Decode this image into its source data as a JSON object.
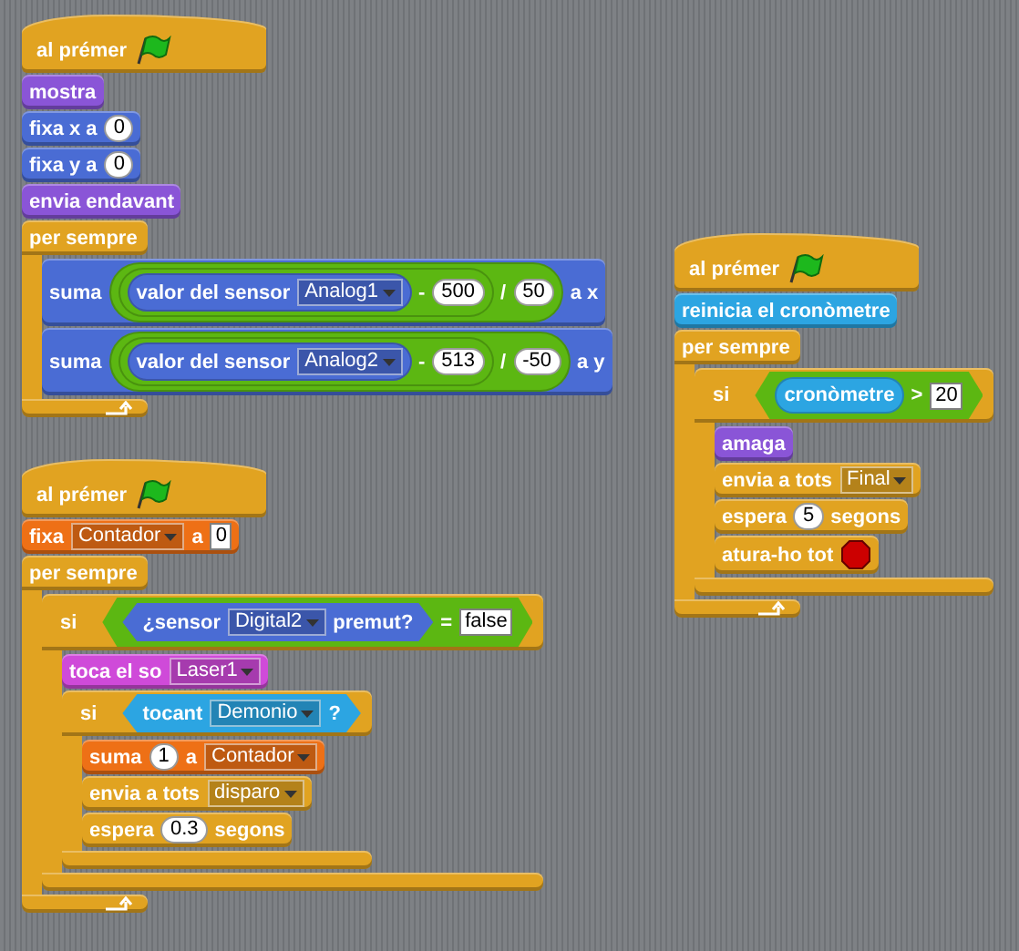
{
  "scripts": [
    {
      "blocks": [
        {
          "kind": "hat",
          "color": "#e1a321",
          "parts": [
            {
              "kind": "text",
              "text": "al prémer"
            },
            {
              "kind": "flag"
            }
          ]
        },
        {
          "kind": "stack",
          "color": "#8a55d7",
          "parts": [
            {
              "kind": "text",
              "text": "mostra"
            }
          ]
        },
        {
          "kind": "stack",
          "color": "#4a6cd4",
          "parts": [
            {
              "kind": "text",
              "text": "fixa x a"
            },
            {
              "kind": "number",
              "text": "0"
            }
          ]
        },
        {
          "kind": "stack",
          "color": "#4a6cd4",
          "parts": [
            {
              "kind": "text",
              "text": "fixa y a"
            },
            {
              "kind": "number",
              "text": "0"
            }
          ]
        },
        {
          "kind": "stack",
          "color": "#8a55d7",
          "parts": [
            {
              "kind": "text",
              "text": "envia endavant"
            }
          ]
        },
        {
          "kind": "forever",
          "color": "#e1a321",
          "parts": [
            {
              "kind": "text",
              "text": "per sempre"
            }
          ],
          "children": [
            {
              "kind": "stack",
              "color": "#4a6cd4",
              "parts": [
                {
                  "kind": "text",
                  "text": "suma"
                },
                {
                  "kind": "reporter",
                  "color": "#5cb712",
                  "parts": [
                    {
                      "kind": "reporter",
                      "color": "#5cb712",
                      "parts": [
                        {
                          "kind": "reporter",
                          "color": "#4a6cd4",
                          "parts": [
                            {
                              "kind": "text",
                              "text": "valor del sensor"
                            },
                            {
                              "kind": "dropdown",
                              "text": "Analog1"
                            }
                          ]
                        },
                        {
                          "kind": "text",
                          "text": "-"
                        },
                        {
                          "kind": "number",
                          "text": "500"
                        }
                      ]
                    },
                    {
                      "kind": "text",
                      "text": "/"
                    },
                    {
                      "kind": "number",
                      "text": "50"
                    }
                  ]
                },
                {
                  "kind": "text",
                  "text": "a x"
                }
              ]
            },
            {
              "kind": "stack",
              "color": "#4a6cd4",
              "parts": [
                {
                  "kind": "text",
                  "text": "suma"
                },
                {
                  "kind": "reporter",
                  "color": "#5cb712",
                  "parts": [
                    {
                      "kind": "reporter",
                      "color": "#5cb712",
                      "parts": [
                        {
                          "kind": "reporter",
                          "color": "#4a6cd4",
                          "parts": [
                            {
                              "kind": "text",
                              "text": "valor del sensor"
                            },
                            {
                              "kind": "dropdown",
                              "text": "Analog2"
                            }
                          ]
                        },
                        {
                          "kind": "text",
                          "text": "-"
                        },
                        {
                          "kind": "number",
                          "text": "513"
                        }
                      ]
                    },
                    {
                      "kind": "text",
                      "text": "/"
                    },
                    {
                      "kind": "number",
                      "text": "-50"
                    }
                  ]
                },
                {
                  "kind": "text",
                  "text": "a y"
                }
              ]
            }
          ]
        }
      ]
    },
    {
      "blocks": [
        {
          "kind": "hat",
          "color": "#e1a321",
          "parts": [
            {
              "kind": "text",
              "text": "al prémer"
            },
            {
              "kind": "flag"
            }
          ]
        },
        {
          "kind": "stack",
          "color": "#2ca5e2",
          "parts": [
            {
              "kind": "text",
              "text": "reinicia el cronòmetre"
            }
          ]
        },
        {
          "kind": "forever",
          "color": "#e1a321",
          "parts": [
            {
              "kind": "text",
              "text": "per sempre"
            }
          ],
          "children": [
            {
              "kind": "if",
              "color": "#e1a321",
              "parts": [
                {
                  "kind": "text",
                  "text": "si"
                },
                {
                  "kind": "boolean",
                  "color": "#5cb712",
                  "parts": [
                    {
                      "kind": "reporter",
                      "color": "#2ca5e2",
                      "parts": [
                        {
                          "kind": "text",
                          "text": "cronòmetre"
                        }
                      ]
                    },
                    {
                      "kind": "text",
                      "text": ">"
                    },
                    {
                      "kind": "field",
                      "text": "20"
                    }
                  ]
                }
              ],
              "children": [
                {
                  "kind": "stack",
                  "color": "#8a55d7",
                  "parts": [
                    {
                      "kind": "text",
                      "text": "amaga"
                    }
                  ]
                },
                {
                  "kind": "stack",
                  "color": "#e1a321",
                  "parts": [
                    {
                      "kind": "text",
                      "text": "envia a tots"
                    },
                    {
                      "kind": "dropdown",
                      "text": "Final"
                    }
                  ]
                },
                {
                  "kind": "stack",
                  "color": "#e1a321",
                  "parts": [
                    {
                      "kind": "text",
                      "text": "espera"
                    },
                    {
                      "kind": "number",
                      "text": "5"
                    },
                    {
                      "kind": "text",
                      "text": "segons"
                    }
                  ]
                },
                {
                  "kind": "stack",
                  "color": "#e1a321",
                  "parts": [
                    {
                      "kind": "text",
                      "text": "atura-ho tot"
                    },
                    {
                      "kind": "stop"
                    }
                  ]
                }
              ]
            }
          ]
        }
      ]
    },
    {
      "blocks": [
        {
          "kind": "hat",
          "color": "#e1a321",
          "parts": [
            {
              "kind": "text",
              "text": "al prémer"
            },
            {
              "kind": "flag"
            }
          ]
        },
        {
          "kind": "stack",
          "color": "#ee7016",
          "parts": [
            {
              "kind": "text",
              "text": "fixa"
            },
            {
              "kind": "dropdown",
              "text": "Contador"
            },
            {
              "kind": "text",
              "text": "a"
            },
            {
              "kind": "field",
              "text": "0"
            }
          ]
        },
        {
          "kind": "forever",
          "color": "#e1a321",
          "parts": [
            {
              "kind": "text",
              "text": "per sempre"
            }
          ],
          "children": [
            {
              "kind": "if",
              "color": "#e1a321",
              "parts": [
                {
                  "kind": "text",
                  "text": "si"
                },
                {
                  "kind": "boolean",
                  "color": "#5cb712",
                  "parts": [
                    {
                      "kind": "boolean",
                      "color": "#4a6cd4",
                      "parts": [
                        {
                          "kind": "text",
                          "text": "¿sensor"
                        },
                        {
                          "kind": "dropdown",
                          "text": "Digital2"
                        },
                        {
                          "kind": "text",
                          "text": "premut?"
                        }
                      ]
                    },
                    {
                      "kind": "text",
                      "text": "="
                    },
                    {
                      "kind": "field",
                      "text": "false"
                    }
                  ]
                }
              ],
              "children": [
                {
                  "kind": "stack",
                  "color": "#cf4ad9",
                  "parts": [
                    {
                      "kind": "text",
                      "text": "toca el so"
                    },
                    {
                      "kind": "dropdown",
                      "text": "Laser1"
                    }
                  ]
                },
                {
                  "kind": "if",
                  "color": "#e1a321",
                  "parts": [
                    {
                      "kind": "text",
                      "text": "si"
                    },
                    {
                      "kind": "boolean",
                      "color": "#2ca5e2",
                      "parts": [
                        {
                          "kind": "text",
                          "text": "tocant"
                        },
                        {
                          "kind": "dropdown",
                          "text": "Demonio"
                        },
                        {
                          "kind": "text",
                          "text": "?"
                        }
                      ]
                    }
                  ],
                  "children": [
                    {
                      "kind": "stack",
                      "color": "#ee7016",
                      "parts": [
                        {
                          "kind": "text",
                          "text": "suma"
                        },
                        {
                          "kind": "number",
                          "text": "1"
                        },
                        {
                          "kind": "text",
                          "text": "a"
                        },
                        {
                          "kind": "dropdown",
                          "text": "Contador"
                        }
                      ]
                    },
                    {
                      "kind": "stack",
                      "color": "#e1a321",
                      "parts": [
                        {
                          "kind": "text",
                          "text": "envia a tots"
                        },
                        {
                          "kind": "dropdown",
                          "text": "disparo"
                        }
                      ]
                    },
                    {
                      "kind": "stack",
                      "color": "#e1a321",
                      "parts": [
                        {
                          "kind": "text",
                          "text": "espera"
                        },
                        {
                          "kind": "number",
                          "text": "0.3"
                        },
                        {
                          "kind": "text",
                          "text": "segons"
                        }
                      ]
                    }
                  ]
                }
              ]
            }
          ]
        }
      ]
    }
  ]
}
